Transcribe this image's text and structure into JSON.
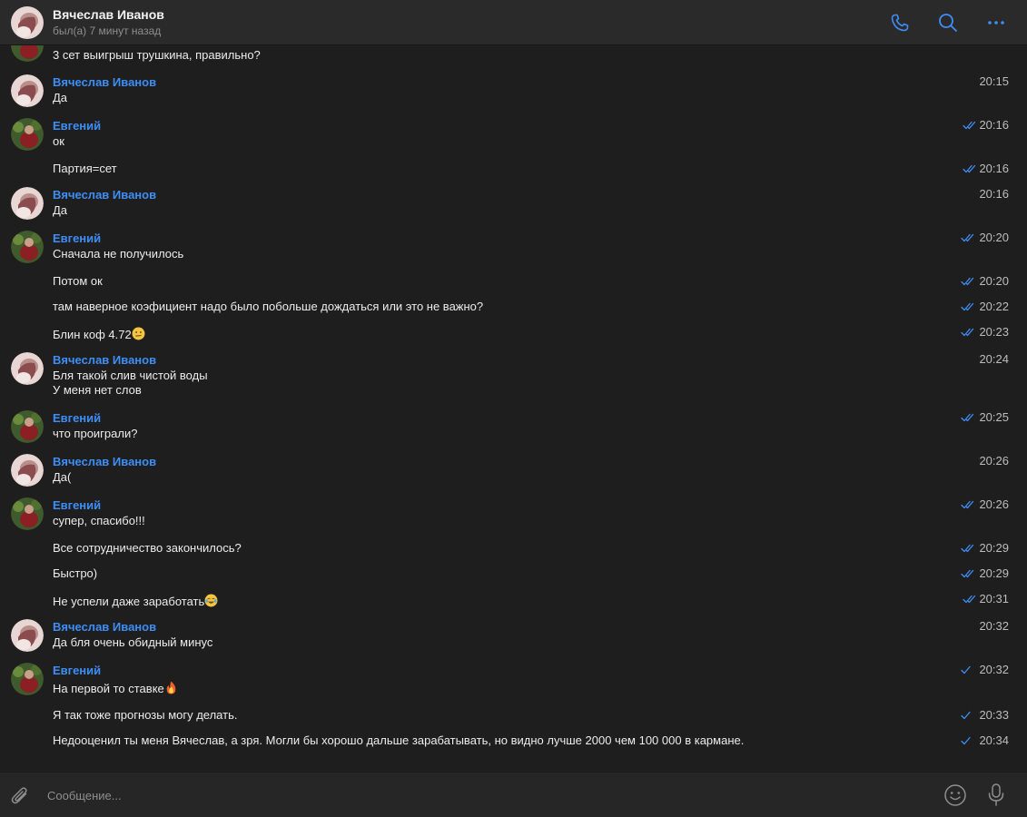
{
  "header": {
    "name": "Вячеслав Иванов",
    "status": "был(а) 7 минут назад"
  },
  "composer": {
    "placeholder": "Сообщение..."
  },
  "colors": {
    "accent": "#3e8ef7",
    "background": "#1e1e1e",
    "header": "#2a2a2a"
  },
  "icons": [
    "phone-icon",
    "search-icon",
    "more-icon",
    "attach-icon",
    "emoji-icon",
    "microphone-icon",
    "double-check-icon",
    "single-check-icon"
  ],
  "messages": [
    {
      "text": "3 сет выигрыш трушкина, правильно?"
    },
    {
      "sender": "Вячеслав Иванов",
      "text": "Да",
      "time": "20:15"
    },
    {
      "sender": "Евгений",
      "text": "ок",
      "time": "20:16"
    },
    {
      "text": "Партия=сет",
      "time": "20:16"
    },
    {
      "sender": "Вячеслав Иванов",
      "text": "Да",
      "time": "20:16"
    },
    {
      "sender": "Евгений",
      "text": "Сначала не получилось",
      "time": "20:20"
    },
    {
      "text": "Потом ок",
      "time": "20:20"
    },
    {
      "text": "там наверное коэфициент надо было побольше дождаться или это не важно?",
      "time": "20:22"
    },
    {
      "text": "Блин коф 4.72",
      "time": "20:23"
    },
    {
      "sender": "Вячеслав Иванов",
      "text": "Бля такой слив чистой воды",
      "text2": "У меня нет слов",
      "time": "20:24"
    },
    {
      "sender": "Евгений",
      "text": "что проиграли?",
      "time": "20:25"
    },
    {
      "sender": "Вячеслав Иванов",
      "text": "Да(",
      "time": "20:26"
    },
    {
      "sender": "Евгений",
      "text": "супер, спасибо!!!",
      "time": "20:26"
    },
    {
      "text": "Все сотрудничество закончилось?",
      "time": "20:29"
    },
    {
      "text": "Быстро)",
      "time": "20:29"
    },
    {
      "text": "Не успели даже заработать",
      "time": "20:31"
    },
    {
      "sender": "Вячеслав Иванов",
      "text": "Да бля очень обидный минус",
      "time": "20:32"
    },
    {
      "sender": "Евгений",
      "text": "На первой то ставке",
      "time": "20:32"
    },
    {
      "text": "Я так тоже прогнозы могу делать.",
      "time": "20:33"
    },
    {
      "text": "Недооценил ты меня Вячеслав, а зря. Могли бы хорошо дальше зарабатывать, но видно лучше 2000 чем 100 000 в кармане.",
      "time": "20:34"
    }
  ]
}
